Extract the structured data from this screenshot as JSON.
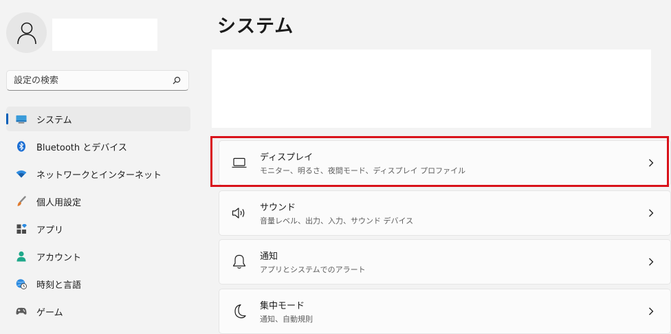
{
  "window": {
    "page_title": "システム"
  },
  "sidebar": {
    "search": {
      "placeholder": "設定の検索",
      "value": ""
    },
    "items": [
      {
        "label": "システム",
        "icon": "system-icon",
        "active": true
      },
      {
        "label": "Bluetooth とデバイス",
        "icon": "bluetooth-icon"
      },
      {
        "label": "ネットワークとインターネット",
        "icon": "wifi-icon"
      },
      {
        "label": "個人用設定",
        "icon": "brush-icon"
      },
      {
        "label": "アプリ",
        "icon": "apps-icon"
      },
      {
        "label": "アカウント",
        "icon": "account-icon"
      },
      {
        "label": "時刻と言語",
        "icon": "globe-clock-icon"
      },
      {
        "label": "ゲーム",
        "icon": "gamepad-icon"
      }
    ]
  },
  "main": {
    "cards": [
      {
        "title": "ディスプレイ",
        "subtitle": "モニター、明るさ、夜間モード、ディスプレイ プロファイル",
        "icon": "display-icon"
      },
      {
        "title": "サウンド",
        "subtitle": "音量レベル、出力、入力、サウンド デバイス",
        "icon": "speaker-icon"
      },
      {
        "title": "通知",
        "subtitle": "アプリとシステムでのアラート",
        "icon": "bell-icon"
      },
      {
        "title": "集中モード",
        "subtitle": "通知、自動規則",
        "icon": "moon-icon"
      }
    ]
  },
  "colors": {
    "accent": "#005fb8",
    "highlight_border": "#d9121a"
  }
}
